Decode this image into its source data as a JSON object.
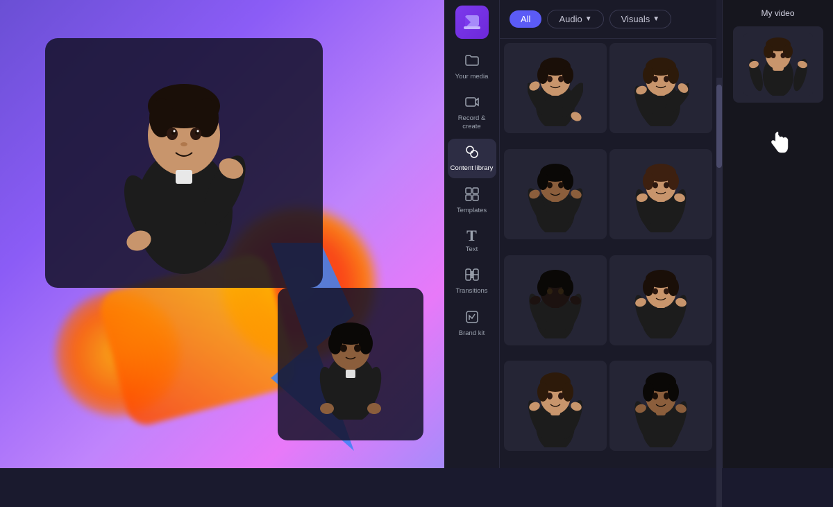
{
  "app": {
    "title": "Clipchamp"
  },
  "sidebar": {
    "items": [
      {
        "id": "your-media",
        "label": "Your media",
        "icon": "📁"
      },
      {
        "id": "record-create",
        "label": "Record &\ncreate",
        "icon": "📹"
      },
      {
        "id": "content-library",
        "label": "Content library",
        "icon": "🎨",
        "active": true
      },
      {
        "id": "templates",
        "label": "Templates",
        "icon": "⊞"
      },
      {
        "id": "text",
        "label": "Text",
        "icon": "T"
      },
      {
        "id": "transitions",
        "label": "Transitions",
        "icon": "✦"
      },
      {
        "id": "brand-kit",
        "label": "Brand kit",
        "icon": "🎴"
      }
    ]
  },
  "filter_bar": {
    "buttons": [
      {
        "id": "all",
        "label": "All",
        "active": true
      },
      {
        "id": "audio",
        "label": "Audio",
        "dropdown": true
      },
      {
        "id": "visuals",
        "label": "Visuals",
        "dropdown": true
      }
    ]
  },
  "my_video": {
    "label": "My video"
  },
  "colors": {
    "accent": "#5b5bf6",
    "bg_dark": "#1a1a28",
    "bg_card": "#252535",
    "text_primary": "#ffffff",
    "text_secondary": "#9ca3af"
  }
}
